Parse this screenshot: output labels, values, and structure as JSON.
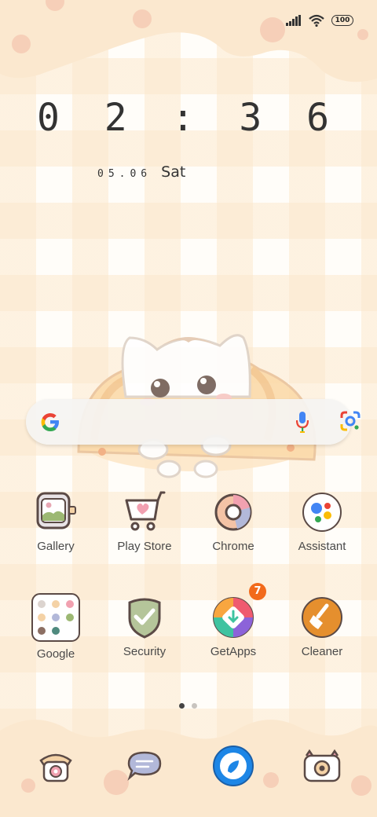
{
  "status_bar": {
    "battery": "100",
    "icons": [
      "signal-icon",
      "wifi-icon",
      "battery-icon"
    ]
  },
  "clock": {
    "time": "0 2 : 3 6",
    "date": "05.06",
    "weekday": "Sat"
  },
  "search": {
    "icons": [
      "google-g-icon",
      "microphone-icon",
      "google-lens-icon"
    ]
  },
  "apps": [
    {
      "label": "Gallery",
      "icon": "gallery-icon"
    },
    {
      "label": "Play Store",
      "icon": "play-store-icon"
    },
    {
      "label": "Chrome",
      "icon": "chrome-icon"
    },
    {
      "label": "Assistant",
      "icon": "assistant-icon"
    },
    {
      "label": "Google",
      "icon": "google-folder-icon"
    },
    {
      "label": "Security",
      "icon": "security-icon"
    },
    {
      "label": "GetApps",
      "icon": "getapps-icon",
      "badge": "7"
    },
    {
      "label": "Cleaner",
      "icon": "cleaner-icon"
    }
  ],
  "page_indicator": {
    "pages": 2,
    "active": 1
  },
  "dock": [
    "phone-icon",
    "messages-icon",
    "browser-icon",
    "camera-icon"
  ],
  "colors": {
    "wallpaper_base": "#fffdf9",
    "wallpaper_check": "#fce8cd",
    "cloud": "#fbe8cf",
    "badge": "#f26a1b",
    "text": "#4a4a4a"
  }
}
